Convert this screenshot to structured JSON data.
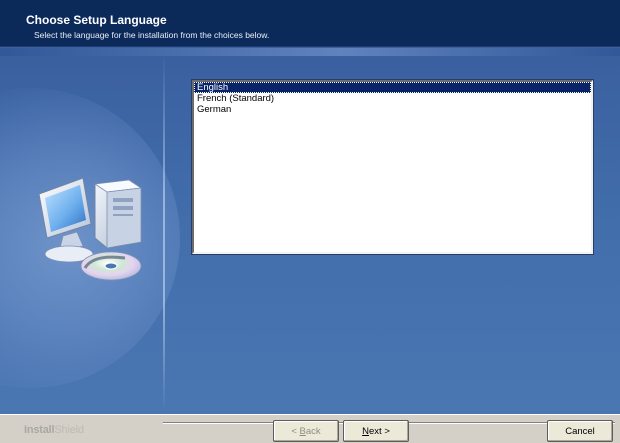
{
  "header": {
    "title": "Choose Setup Language",
    "subtitle": "Select the language for the installation from the choices below."
  },
  "languages": {
    "items": [
      {
        "label": "English",
        "selected": true
      },
      {
        "label": "French (Standard)",
        "selected": false
      },
      {
        "label": "German",
        "selected": false
      }
    ]
  },
  "footer": {
    "brand_bold": "Install",
    "brand_light": "Shield"
  },
  "buttons": {
    "back": {
      "prefix": "< ",
      "accel": "B",
      "rest": "ack",
      "enabled": false
    },
    "next": {
      "accel": "N",
      "rest": "ext",
      "suffix": " >",
      "enabled": true
    },
    "cancel": {
      "label": "Cancel",
      "enabled": true
    }
  },
  "icons": {
    "setup_computer": "computer-with-cd-icon"
  },
  "colors": {
    "header_bg": "#0b2a5a",
    "body_bg": "#4370ad",
    "selection": "#0a246a",
    "footer_bg": "#d4d0c8"
  }
}
